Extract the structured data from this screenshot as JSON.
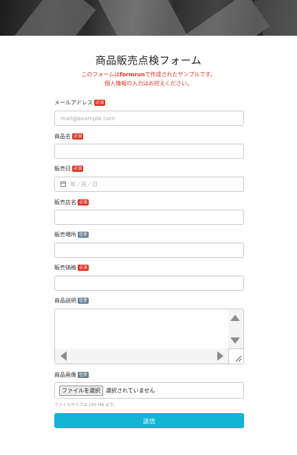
{
  "form": {
    "title": "商品販売点検フォーム",
    "notice_prefix": "このフォームは",
    "notice_brand": "formrun",
    "notice_suffix": "で作成されたサンプルです。",
    "notice_line2": "個人情報の入力はお控えください。"
  },
  "badges": {
    "required": "必須",
    "optional": "任意"
  },
  "fields": {
    "email": {
      "label": "メールアドレス",
      "placeholder": "mail@example.com",
      "badge": "必須"
    },
    "product_name": {
      "label": "商品名",
      "badge": "必須"
    },
    "sale_date": {
      "label": "販売日",
      "placeholder": "年／月／日",
      "badge": "必須"
    },
    "store_name": {
      "label": "販売店名",
      "badge": "必須"
    },
    "sale_place": {
      "label": "販売場所",
      "badge": "任意"
    },
    "price": {
      "label": "販売価格",
      "badge": "必須"
    },
    "description": {
      "label": "商品説明",
      "badge": "任意"
    },
    "image": {
      "label": "商品画像",
      "badge": "任意",
      "button": "ファイルを選択",
      "status": "選択されていません",
      "hint": "ファイルサイズは 100 MB 以下。"
    }
  },
  "submit_label": "送信",
  "colors": {
    "accent": "#12b5d6",
    "required": "#e0301e",
    "optional": "#6b7f8e"
  }
}
